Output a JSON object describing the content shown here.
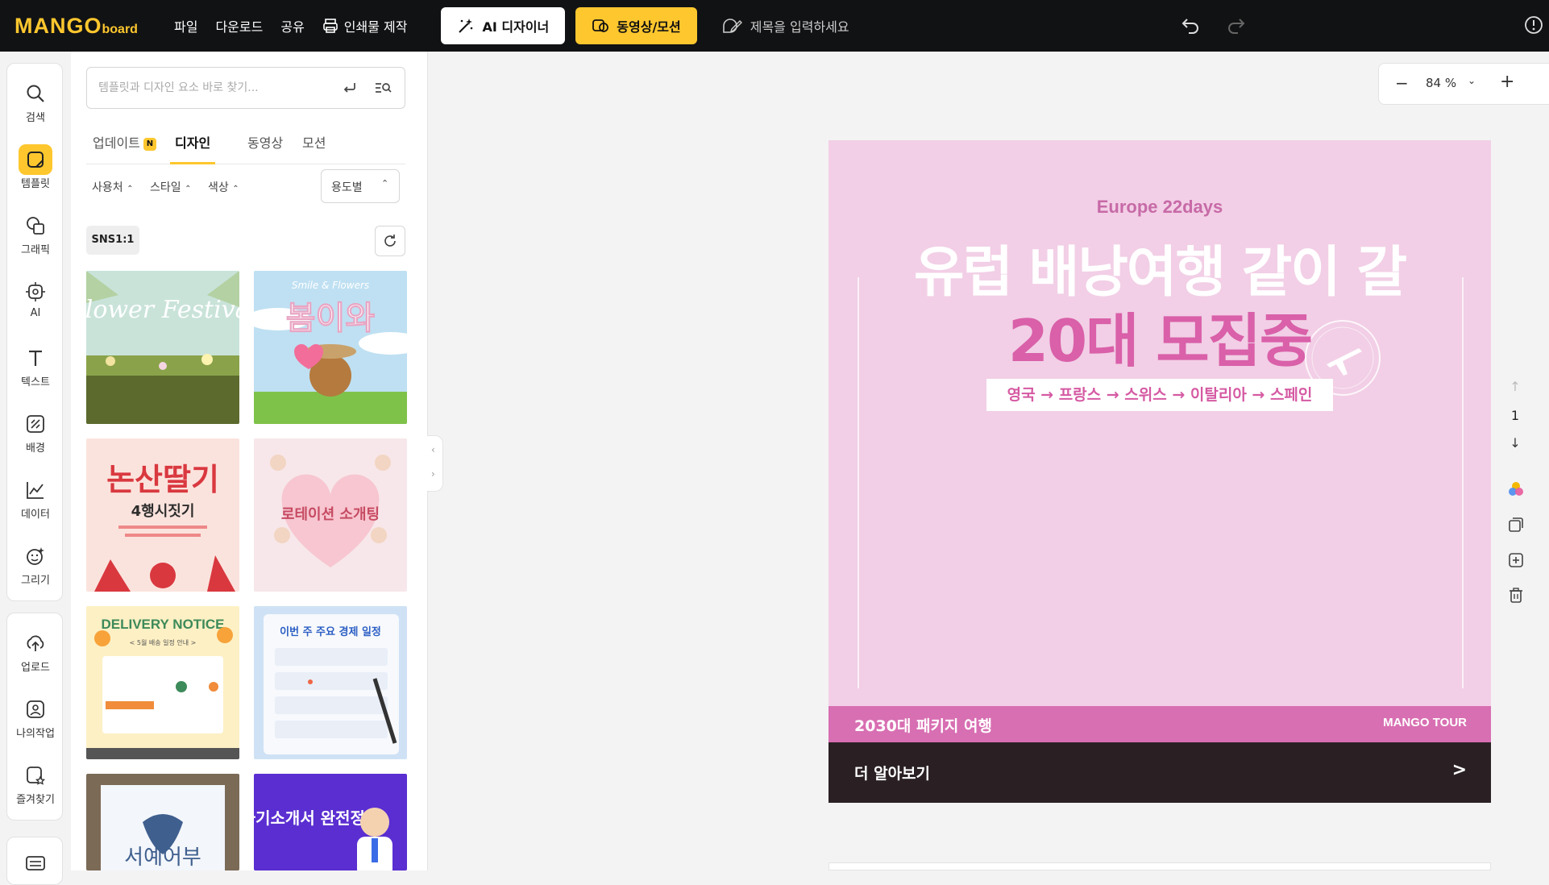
{
  "app": {
    "logo_main": "MANGO",
    "logo_sub": "board"
  },
  "topbar": {
    "menu": [
      "파일",
      "다운로드",
      "공유"
    ],
    "print_label": "인쇄물 제작",
    "ai_label": "AI 디자이너",
    "video_label": "동영상/모션",
    "title_placeholder": "제목을 입력하세요"
  },
  "rail": {
    "items": [
      {
        "label": "검색",
        "icon": "search-icon"
      },
      {
        "label": "템플릿",
        "icon": "template-icon"
      },
      {
        "label": "그래픽",
        "icon": "graphic-icon"
      },
      {
        "label": "AI",
        "icon": "ai-chip-icon"
      },
      {
        "label": "텍스트",
        "icon": "text-icon"
      },
      {
        "label": "배경",
        "icon": "background-icon"
      },
      {
        "label": "데이터",
        "icon": "chart-line-icon"
      },
      {
        "label": "그리기",
        "icon": "draw-icon"
      }
    ],
    "items2": [
      {
        "label": "업로드",
        "icon": "upload-icon"
      },
      {
        "label": "나의작업",
        "icon": "my-work-icon"
      },
      {
        "label": "즐겨찾기",
        "icon": "favorites-icon"
      }
    ]
  },
  "panel": {
    "search_placeholder": "템플릿과 디자인 요소 바로 찾기...",
    "tabs": {
      "update": "업데이트",
      "update_badge": "N",
      "design": "디자인",
      "video": "동영상",
      "motion": "모션"
    },
    "filters": {
      "use": "사용처",
      "style": "스타일",
      "color": "색상",
      "sort": "용도별"
    },
    "size_chip": "SNS1:1",
    "thumbnails": [
      {
        "title": "Flower Festival",
        "bg": "#b9d7cf"
      },
      {
        "title": "봄이와",
        "sub": "Smile & Flowers",
        "bg": "#bfe0f2"
      },
      {
        "title": "논산딸기",
        "sub": "4행시짓기",
        "bg": "#f8d8d2"
      },
      {
        "title": "로테이션 소개팅",
        "bg": "#f7e0e4"
      },
      {
        "title": "DELIVERY NOTICE",
        "sub": "< 5월 배송 일정 안내 >",
        "bg": "#fdf0c4"
      },
      {
        "title": "이번 주 주요 경제 일정",
        "bg": "#d8e8f8"
      },
      {
        "title": "서예어부",
        "bg": "#7b6a56"
      },
      {
        "title": "자기소개서 완전정복",
        "bg": "#5a2ed1"
      }
    ]
  },
  "canvas": {
    "zoom": "84 %",
    "page_number": "1",
    "design": {
      "subtitle": "Europe 22days",
      "headline1": "유럽 배낭여행 같이 갈",
      "headline2": "20대 모집중",
      "route": "영국 → 프랑스 → 스위스 → 이탈리아 → 스페인",
      "bar_left": "2030대 패키지 여행",
      "bar_right": "MANGO TOUR",
      "cta": "더 알아보기",
      "cta_arrow": ">",
      "bg": "#f2cfe6"
    }
  },
  "colors": {
    "accent": "#fec72e",
    "topbar": "#111214",
    "pink": "#d960a9"
  }
}
